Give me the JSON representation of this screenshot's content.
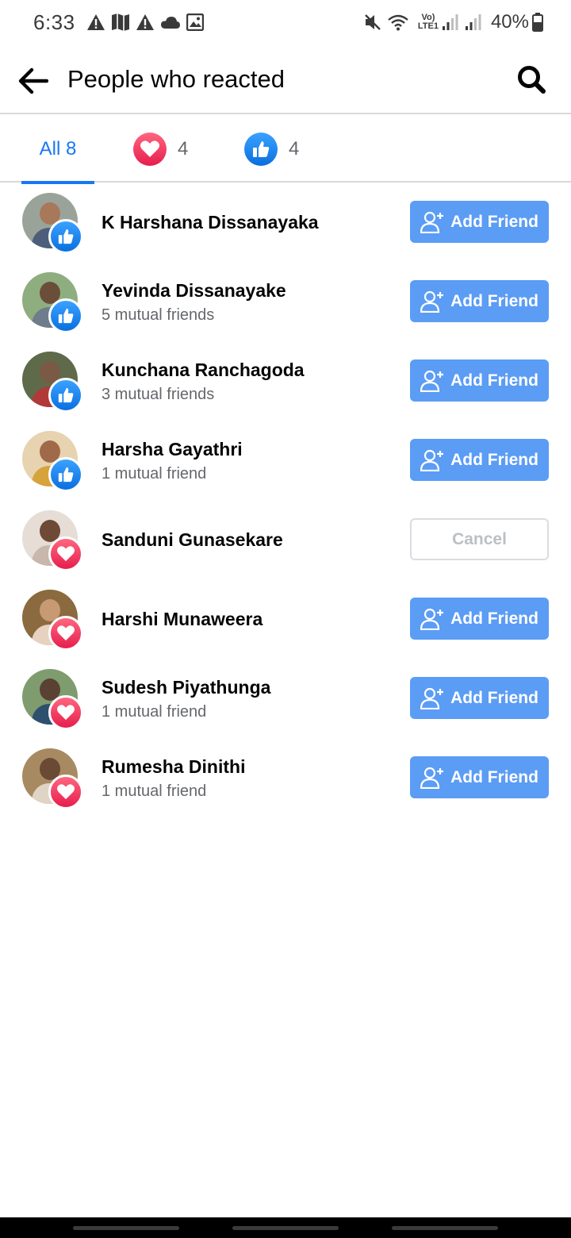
{
  "status_bar": {
    "time": "6:33",
    "battery": "40%",
    "network_label_top": "Vo)",
    "network_label_bottom": "LTE1",
    "icons": [
      "warning-icon",
      "maps-icon",
      "warning-icon",
      "cloud-icon",
      "image-icon",
      "mute-icon",
      "wifi-icon",
      "signal-icon",
      "signal-icon",
      "battery-icon"
    ]
  },
  "header": {
    "title": "People who reacted",
    "back_icon": "arrow-left-icon",
    "search_icon": "search-icon"
  },
  "tabs": {
    "all_label": "All 8",
    "love_count": "4",
    "like_count": "4",
    "selected": "All 8"
  },
  "reactors": [
    {
      "name": "K Harshana Dissanayaka",
      "mutual": "",
      "reaction": "like",
      "action": "Add Friend"
    },
    {
      "name": "Yevinda Dissanayake",
      "mutual": "5 mutual friends",
      "reaction": "like",
      "action": "Add Friend"
    },
    {
      "name": "Kunchana Ranchagoda",
      "mutual": "3 mutual friends",
      "reaction": "like",
      "action": "Add Friend"
    },
    {
      "name": "Harsha Gayathri",
      "mutual": "1 mutual friend",
      "reaction": "like",
      "action": "Add Friend"
    },
    {
      "name": "Sanduni Gunasekare",
      "mutual": "",
      "reaction": "love",
      "action": "Cancel"
    },
    {
      "name": "Harshi Munaweera",
      "mutual": "",
      "reaction": "love",
      "action": "Add Friend"
    },
    {
      "name": "Sudesh Piyathunga",
      "mutual": "1 mutual friend",
      "reaction": "love",
      "action": "Add Friend"
    },
    {
      "name": "Rumesha Dinithi",
      "mutual": "1 mutual friend",
      "reaction": "love",
      "action": "Add Friend"
    }
  ],
  "colors": {
    "brand_blue": "#1877f2",
    "add_button": "#5b9cf5",
    "love": "#e61e4d",
    "like": "#0a6fe0",
    "secondary_text": "#65676b"
  }
}
